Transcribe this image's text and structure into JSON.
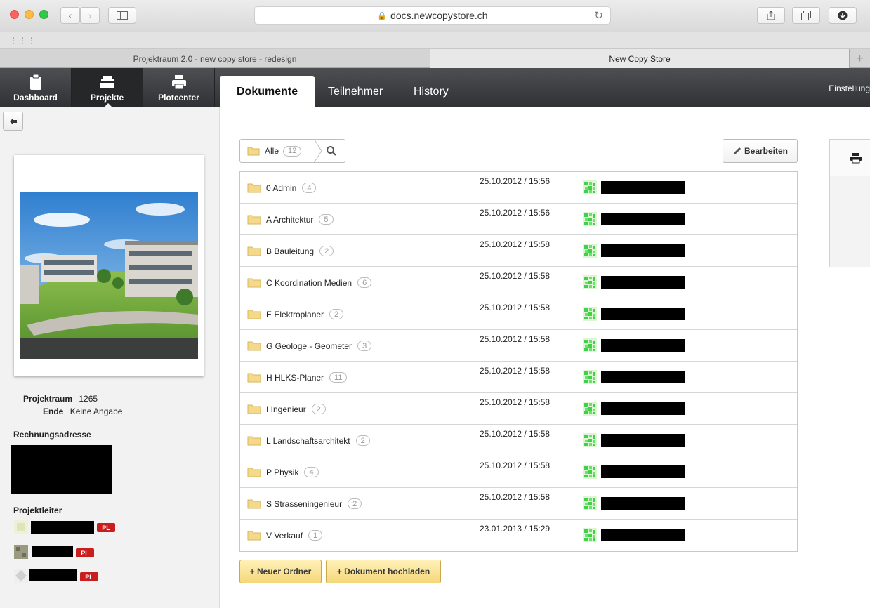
{
  "browser": {
    "url": "docs.newcopystore.ch",
    "tabs": [
      {
        "label": "Projektraum 2.0 - new copy store - redesign"
      },
      {
        "label": "New Copy Store"
      }
    ],
    "new_tab_label": "+"
  },
  "app": {
    "nav": [
      {
        "label": "Dashboard"
      },
      {
        "label": "Projekte"
      },
      {
        "label": "Plotcenter"
      }
    ],
    "subtabs": [
      {
        "label": "Dokumente"
      },
      {
        "label": "Teilnehmer"
      },
      {
        "label": "History"
      }
    ],
    "settings_label": "Einstellung"
  },
  "project": {
    "room_label": "Projektraum",
    "room_value": "1265",
    "end_label": "Ende",
    "end_value": "Keine Angabe",
    "billing_label": "Rechnungsadresse",
    "leader_label": "Projektleiter",
    "pl_badge": "PL"
  },
  "documents": {
    "breadcrumb_all": "Alle",
    "total_count": "12",
    "edit_label": "Bearbeiten",
    "folders": [
      {
        "name": "0 Admin",
        "count": "4",
        "date": "25.10.2012 / 15:56"
      },
      {
        "name": "A Architektur",
        "count": "5",
        "date": "25.10.2012 / 15:56"
      },
      {
        "name": "B Bauleitung",
        "count": "2",
        "date": "25.10.2012 / 15:58"
      },
      {
        "name": "C Koordination Medien",
        "count": "6",
        "date": "25.10.2012 / 15:58"
      },
      {
        "name": "E Elektroplaner",
        "count": "2",
        "date": "25.10.2012 / 15:58"
      },
      {
        "name": "G Geologe - Geometer",
        "count": "3",
        "date": "25.10.2012 / 15:58"
      },
      {
        "name": "H HLKS-Planer",
        "count": "11",
        "date": "25.10.2012 / 15:58"
      },
      {
        "name": "I Ingenieur",
        "count": "2",
        "date": "25.10.2012 / 15:58"
      },
      {
        "name": "L Landschaftsarchitekt",
        "count": "2",
        "date": "25.10.2012 / 15:58"
      },
      {
        "name": "P Physik",
        "count": "4",
        "date": "25.10.2012 / 15:58"
      },
      {
        "name": "S Strasseningenieur",
        "count": "2",
        "date": "25.10.2012 / 15:58"
      },
      {
        "name": "V Verkauf",
        "count": "1",
        "date": "23.01.2013 / 15:29"
      }
    ],
    "new_folder_label": "+ Neuer Ordner",
    "upload_label": "+ Dokument hochladen"
  },
  "colors": {
    "header_dark": "#2f3134",
    "button_yellow": "#f5d77a",
    "badge_red": "#c81e1e"
  }
}
